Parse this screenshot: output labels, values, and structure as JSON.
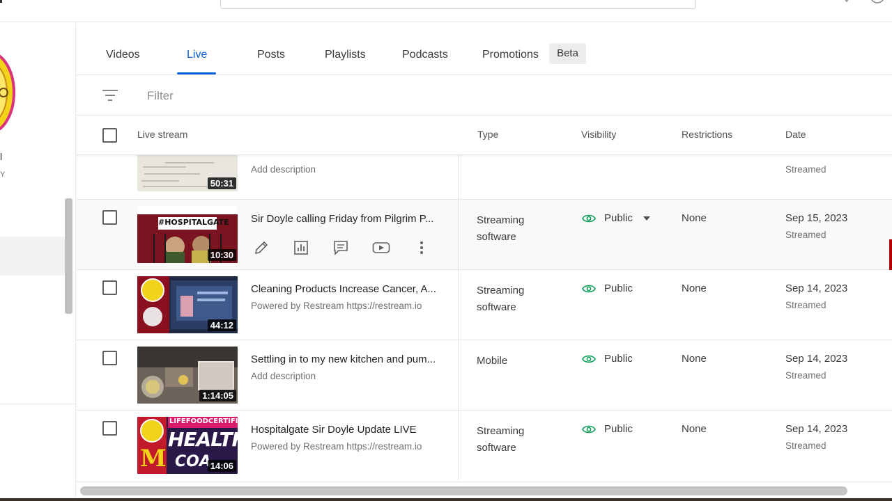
{
  "filter": {
    "placeholder": "Filter"
  },
  "tabs": [
    {
      "label": "Videos"
    },
    {
      "label": "Live"
    },
    {
      "label": "Posts"
    },
    {
      "label": "Playlists"
    },
    {
      "label": "Podcasts"
    },
    {
      "label": "Promotions"
    }
  ],
  "beta_badge": "Beta",
  "sidebar": {
    "channel_name_fragment": "l",
    "channel_sub_fragment": "Y"
  },
  "columns": {
    "live_stream": "Live stream",
    "type": "Type",
    "visibility": "Visibility",
    "restrictions": "Restrictions",
    "date": "Date"
  },
  "rows": [
    {
      "duration": "50:31",
      "title": "",
      "description": "Add description",
      "type": "",
      "visibility": "",
      "restrictions": "",
      "date": "",
      "date_status": "Streamed"
    },
    {
      "duration": "10:30",
      "title": "Sir Doyle calling Friday from Pilgrim P...",
      "description": "",
      "type": "Streaming software",
      "visibility": "Public",
      "restrictions": "None",
      "date": "Sep 15, 2023",
      "date_status": "Streamed",
      "thumb_text": "#HOSPITALGATE"
    },
    {
      "duration": "44:12",
      "title": "Cleaning Products Increase Cancer, A...",
      "description": "Powered by Restream https://restream.io",
      "type": "Streaming software",
      "visibility": "Public",
      "restrictions": "None",
      "date": "Sep 14, 2023",
      "date_status": "Streamed"
    },
    {
      "duration": "1:14:05",
      "title": "Settling in to my new kitchen and pum...",
      "description": "Add description",
      "type": "Mobile",
      "visibility": "Public",
      "restrictions": "None",
      "date": "Sep 14, 2023",
      "date_status": "Streamed"
    },
    {
      "duration": "14:06",
      "title": "Hospitalgate Sir Doyle Update LIVE",
      "description": "Powered by Restream https://restream.io",
      "type": "Streaming software",
      "visibility": "Public",
      "restrictions": "None",
      "date": "Sep 14, 2023",
      "date_status": "Streamed",
      "thumb_text_top": "LIFEFOODCERTIFIED",
      "thumb_text_main": "HEALTH",
      "thumb_text_bottom": "COA",
      "thumb_letter": "M"
    }
  ],
  "icons": {
    "row_actions": [
      "pencil-icon",
      "analytics-icon",
      "comments-icon",
      "youtube-icon",
      "more-vert-icon"
    ],
    "visibility": "eye-icon",
    "filter": "filter-icon",
    "dropdown": "caret-down-icon"
  },
  "colors": {
    "accent": "#065fd4",
    "public_green": "#0f9d58"
  }
}
